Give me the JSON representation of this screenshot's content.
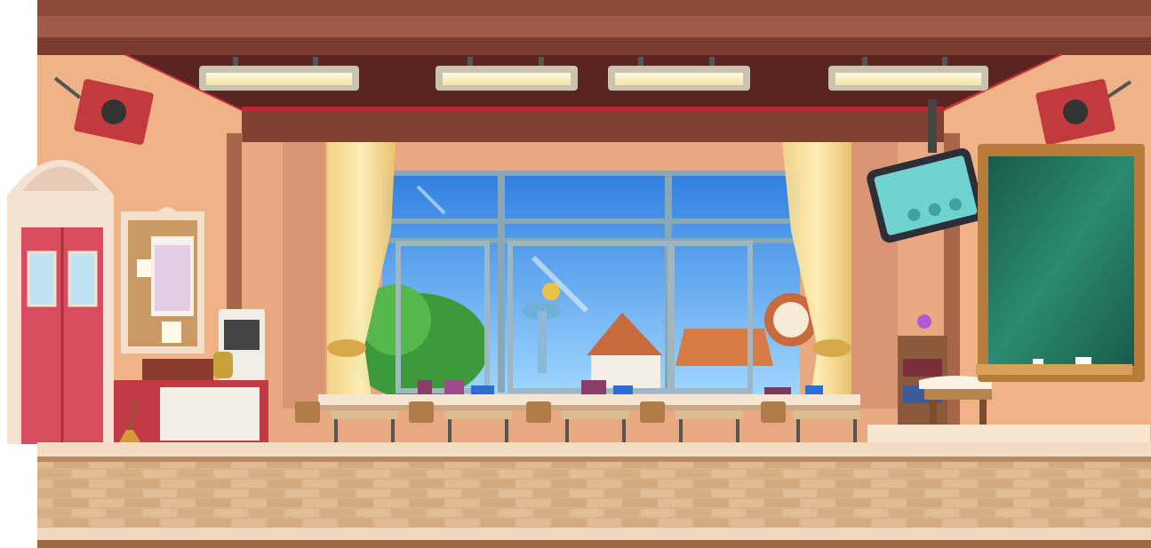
{
  "scene": {
    "name": "classroom-map-background",
    "style": "2D side-scrolling game backdrop",
    "sky_color": "#4aa3f5",
    "wall_color": "#f0b287",
    "floor_color": "#d7b48e",
    "board_color": "#1f6b5c",
    "door_color": "#d94b5e"
  },
  "tablet": {
    "icons": [
      "power-icon",
      "settings-icon",
      "leaf-icon",
      "clock-icon"
    ]
  },
  "chalkboard": {
    "text": ""
  }
}
